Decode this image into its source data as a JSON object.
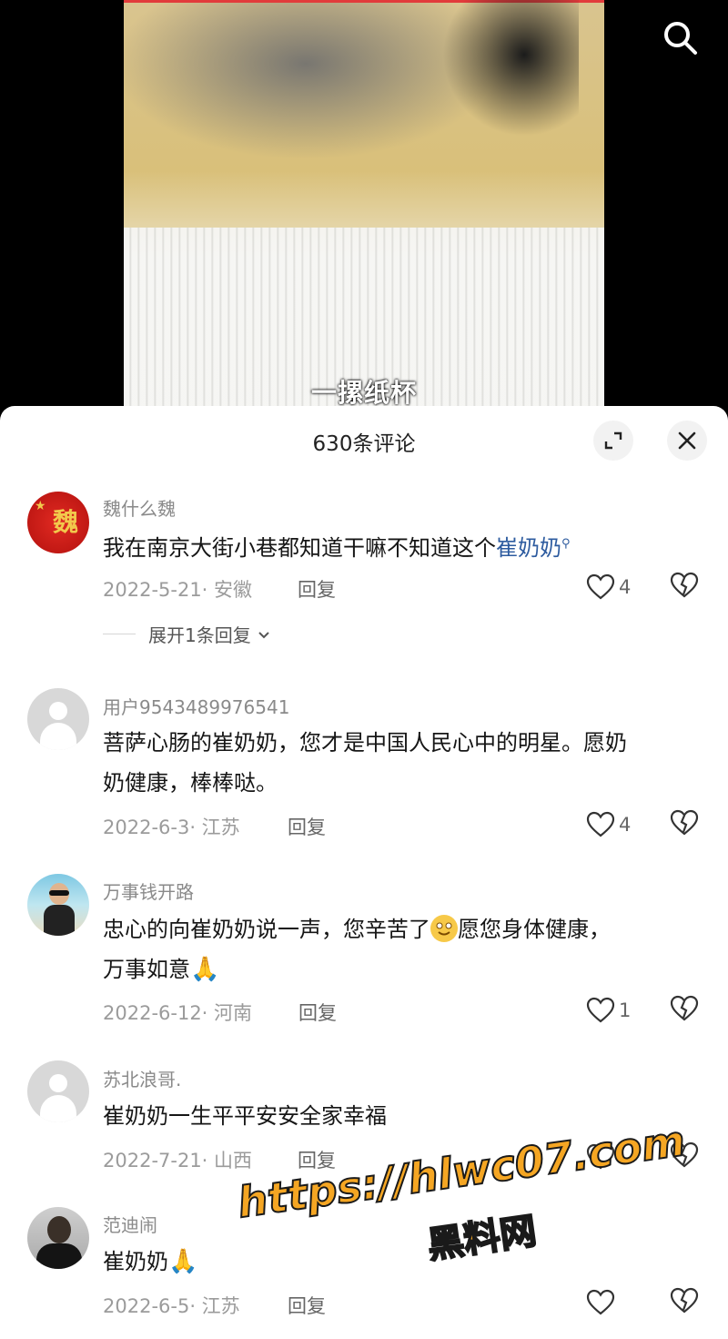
{
  "video": {
    "subtitle": "一摞纸杯"
  },
  "panel": {
    "title": "630条评论"
  },
  "comments": [
    {
      "username": "魏什么魏",
      "text_pre": "我在南京大街小巷都知道干嘛不知道这个",
      "text_link": "崔奶奶",
      "date_loc": "2022-5-21· 安徽",
      "reply": "回复",
      "likes": "4",
      "expand_label": "展开1条回复",
      "avatar_char": "魏"
    },
    {
      "username": "用户9543489976541",
      "text_line1": "菩萨心肠的崔奶奶，您才是中国人民心中的明星。愿奶",
      "text_line2": "奶健康，棒棒哒。",
      "date_loc": "2022-6-3· 江苏",
      "reply": "回复",
      "likes": "4"
    },
    {
      "username": "万事钱开路",
      "text_line1_a": "忠心的向崔奶奶说一声，您辛苦了",
      "text_line1_b": "愿您身体健康，",
      "text_line2": "万事如意",
      "date_loc": "2022-6-12· 河南",
      "reply": "回复",
      "likes": "1"
    },
    {
      "username": "苏北浪哥.",
      "text": "崔奶奶一生平平安安全家幸福",
      "date_loc": "2022-7-21· 山西",
      "reply": "回复"
    },
    {
      "username": "范迪闹",
      "text": "崔奶奶",
      "date_loc": "2022-6-5· 江苏",
      "reply": "回复"
    }
  ],
  "watermark": {
    "url": "https://hlwc07.com",
    "site": "黑料网"
  },
  "icons": {
    "search": "search-icon",
    "expand": "expand-icon",
    "close": "close-icon",
    "heart": "heart-icon",
    "broken_heart": "broken-heart-icon",
    "chevron": "chevron-down-icon"
  }
}
